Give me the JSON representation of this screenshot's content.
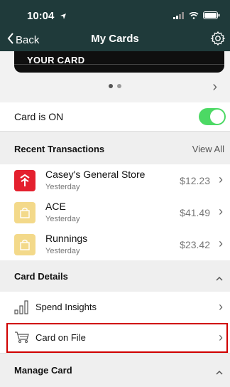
{
  "status_bar": {
    "time": "10:04"
  },
  "nav": {
    "back_label": "Back",
    "title": "My Cards"
  },
  "card": {
    "label": "YOUR CARD"
  },
  "card_status": {
    "label": "Card is ON",
    "on": true
  },
  "recent": {
    "title": "Recent Transactions",
    "view_all": "View All",
    "items": [
      {
        "merchant": "Casey's General Store",
        "date": "Yesterday",
        "amount": "$12.23"
      },
      {
        "merchant": "ACE",
        "date": "Yesterday",
        "amount": "$41.49"
      },
      {
        "merchant": "Runnings",
        "date": "Yesterday",
        "amount": "$23.42"
      }
    ]
  },
  "card_details": {
    "title": "Card Details",
    "items": [
      {
        "label": "Spend Insights"
      },
      {
        "label": "Card on File"
      }
    ]
  },
  "manage_card": {
    "title": "Manage Card"
  },
  "colors": {
    "header_bg": "#1f3a3a",
    "toggle_on": "#4cd964",
    "highlight": "#d00000"
  }
}
